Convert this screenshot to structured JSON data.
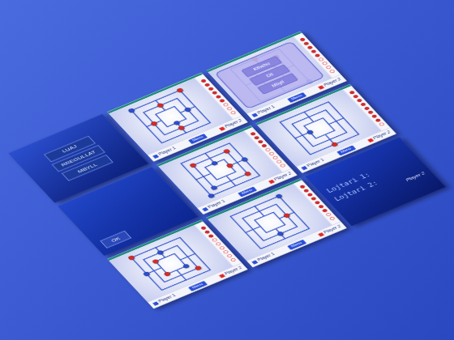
{
  "tiles": [
    {
      "kind": "menu",
      "buttons": [
        "LUAJ",
        "RREGULLAT",
        "MBYLL"
      ]
    },
    {
      "kind": "board",
      "player1": "Player 1",
      "player2": "Player 2",
      "menu": "Menu",
      "reserve": 6,
      "pieces": [
        {
          "point": 0,
          "color": "#2a4fd8"
        },
        {
          "point": 2,
          "color": "#e02828"
        },
        {
          "point": 9,
          "color": "#e02828"
        },
        {
          "point": 11,
          "color": "#2a4fd8"
        },
        {
          "point": 13,
          "color": "#e02828"
        },
        {
          "point": 15,
          "color": "#e02828"
        },
        {
          "point": 21,
          "color": "#2a4fd8"
        }
      ]
    },
    {
      "kind": "dialog",
      "buttons": [
        "Kthehu",
        "Dil",
        "Mbyll"
      ],
      "player1": "Player 1",
      "player2": "Player 2",
      "menu": "Menu",
      "reserve": 5,
      "pieces": [
        {
          "point": 1,
          "color": "#e02828"
        },
        {
          "point": 4,
          "color": "#2a4fd8"
        },
        {
          "point": 10,
          "color": "#e02828"
        },
        {
          "point": 18,
          "color": "#2a4fd8"
        }
      ]
    },
    {
      "kind": "ok",
      "button": "OK"
    },
    {
      "kind": "board",
      "player1": "Player 1",
      "player2": "Player 2",
      "menu": "Menu",
      "reserve": 4,
      "pieces": [
        {
          "point": 8,
          "color": "#e02828"
        },
        {
          "point": 10,
          "color": "#e02828"
        },
        {
          "point": 12,
          "color": "#e02828"
        },
        {
          "point": 14,
          "color": "#2a4fd8"
        },
        {
          "point": 17,
          "color": "#2a4fd8"
        },
        {
          "point": 19,
          "color": "#e02828"
        },
        {
          "point": 3,
          "color": "#2a4fd8"
        },
        {
          "point": 6,
          "color": "#2a4fd8"
        }
      ]
    },
    {
      "kind": "board",
      "player1": "Player 1",
      "player2": "Player 2",
      "menu": "Menu",
      "reserve": 8,
      "pieces": [
        {
          "point": 5,
          "color": "#e02828"
        },
        {
          "point": 23,
          "color": "#2a4fd8"
        }
      ]
    },
    {
      "kind": "board",
      "player1": "Player 1",
      "player2": "Player 2",
      "menu": "Menu",
      "reserve": 3,
      "pieces": [
        {
          "point": 0,
          "color": "#e02828"
        },
        {
          "point": 7,
          "color": "#2a4fd8"
        },
        {
          "point": 9,
          "color": "#2a4fd8"
        },
        {
          "point": 12,
          "color": "#e02828"
        },
        {
          "point": 16,
          "color": "#e02828"
        },
        {
          "point": 20,
          "color": "#2a4fd8"
        },
        {
          "point": 22,
          "color": "#e02828"
        }
      ]
    },
    {
      "kind": "board",
      "player1": "Player 1",
      "player2": "Player 2",
      "menu": "Menu",
      "reserve": 7,
      "pieces": [
        {
          "point": 2,
          "color": "#2a4fd8"
        },
        {
          "point": 11,
          "color": "#e02828"
        },
        {
          "point": 13,
          "color": "#2a4fd8"
        }
      ]
    },
    {
      "kind": "score",
      "lines": [
        "Lojtari 1:",
        "Lojtari 2:"
      ],
      "player2": "Player 2"
    }
  ]
}
